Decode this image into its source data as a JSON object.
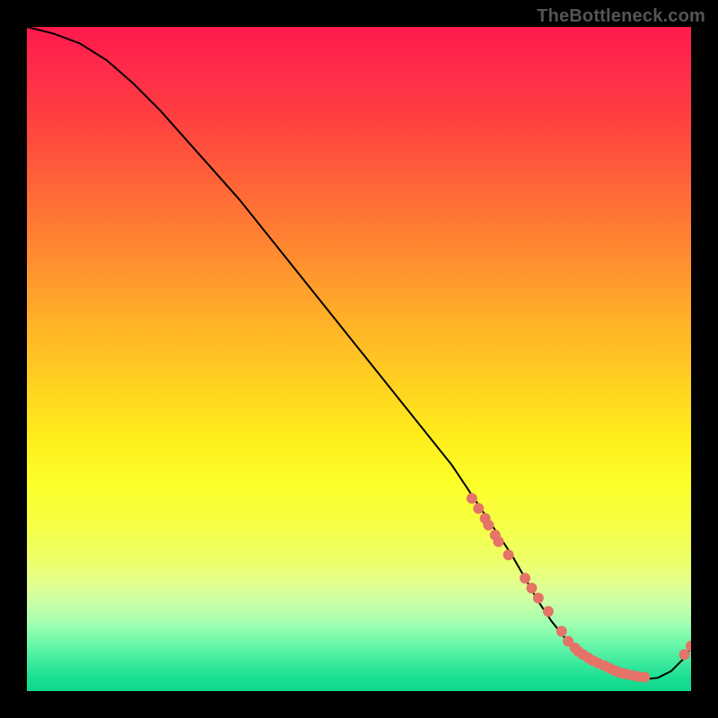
{
  "watermark": "TheBottleneck.com",
  "colors": {
    "dot": "#e57368",
    "line": "#000000"
  },
  "chart_data": {
    "type": "line",
    "title": "",
    "xlabel": "",
    "ylabel": "",
    "xlim": [
      0,
      100
    ],
    "ylim": [
      0,
      100
    ],
    "grid": false,
    "legend": false,
    "series": [
      {
        "name": "curve",
        "x": [
          0,
          4,
          8,
          12,
          16,
          20,
          24,
          28,
          32,
          36,
          40,
          44,
          48,
          52,
          56,
          60,
          64,
          67,
          70,
          73,
          75,
          77,
          79,
          81,
          83,
          85,
          87,
          89,
          91,
          93,
          95,
          97,
          99,
          100
        ],
        "values": [
          100,
          99,
          97.5,
          95,
          91.5,
          87.5,
          83,
          78.5,
          74,
          69,
          64,
          59,
          54,
          49,
          44,
          39,
          34,
          29.5,
          25,
          20.5,
          17,
          13.5,
          10.5,
          8,
          6,
          4.5,
          3.3,
          2.5,
          2.0,
          1.8,
          2.0,
          3.0,
          5.0,
          6.5
        ]
      }
    ],
    "scatter_points": {
      "name": "dots",
      "x": [
        67,
        68,
        69,
        69.5,
        70.5,
        71,
        72.5,
        75,
        76,
        77,
        78.5,
        80.5,
        81.5,
        82.5,
        83,
        83.7,
        84.5,
        85.2,
        86,
        87,
        87.8,
        88.5,
        89.2,
        90,
        91,
        92,
        93,
        99,
        100
      ],
      "values": [
        29,
        27.5,
        26,
        25,
        23.5,
        22.5,
        20.5,
        17,
        15.5,
        14,
        12,
        9,
        7.5,
        6.5,
        6,
        5.5,
        5,
        4.6,
        4.2,
        3.8,
        3.4,
        3.1,
        2.8,
        2.6,
        2.4,
        2.2,
        2.1,
        5.5,
        6.8
      ]
    }
  }
}
